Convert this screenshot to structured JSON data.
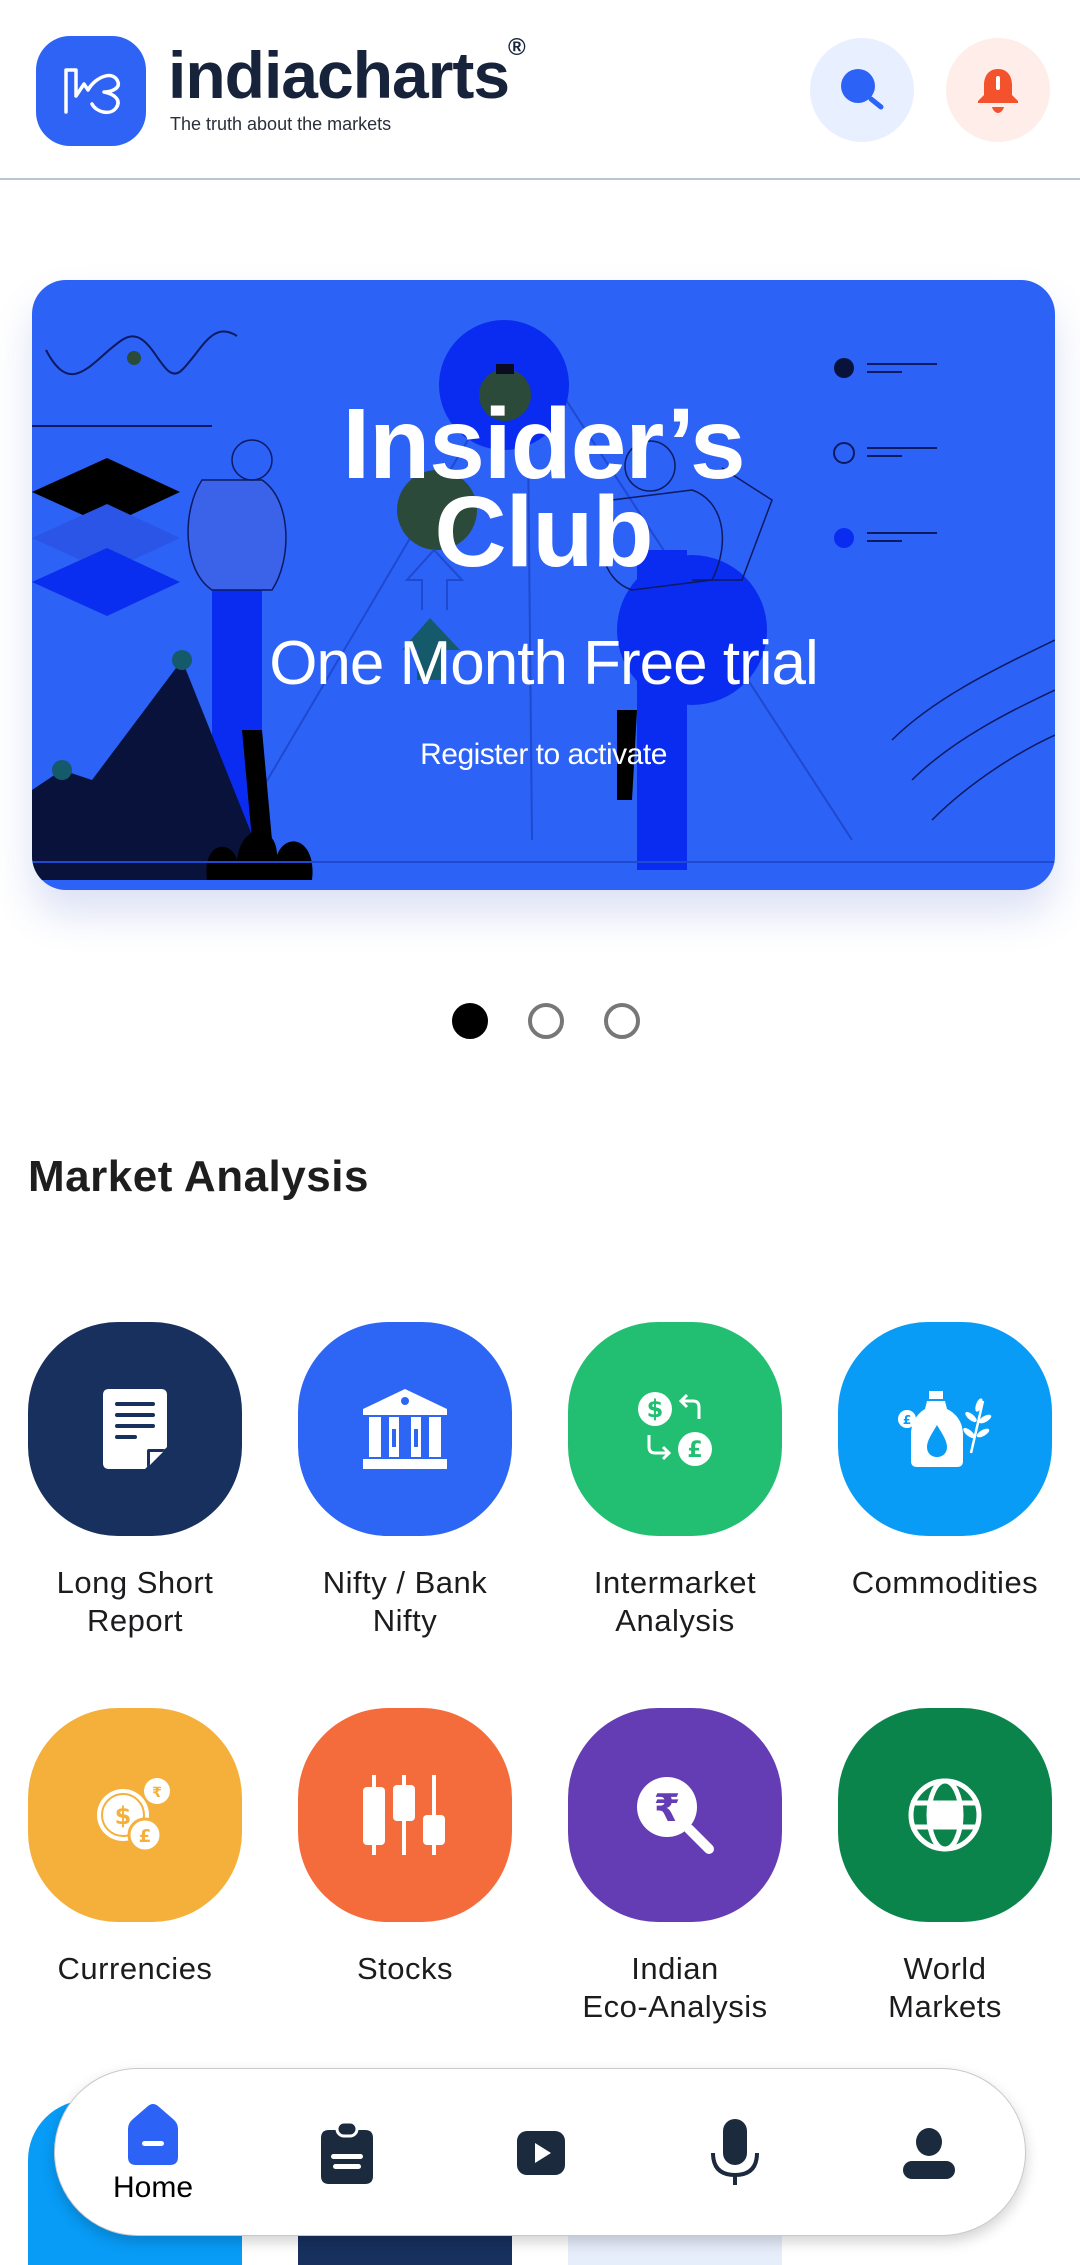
{
  "header": {
    "brand_name": "indiacharts",
    "brand_registered": "®",
    "tagline": "The truth about the markets",
    "search_icon": "search-icon",
    "notification_icon": "bell-icon"
  },
  "banner": {
    "title_line1": "Insider’s",
    "title_line2": "Club",
    "subtitle": "One Month Free trial",
    "cta": "Register to activate",
    "pager": {
      "total": 3,
      "active": 1
    }
  },
  "market_analysis": {
    "title": "Market Analysis",
    "tiles": [
      {
        "label_line1": "Long Short",
        "label_line2": "Report",
        "icon": "document-icon",
        "color": "#17305e"
      },
      {
        "label_line1": "Nifty / Bank",
        "label_line2": "Nifty",
        "icon": "bank-icon",
        "color": "#2d66f5"
      },
      {
        "label_line1": "Intermarket",
        "label_line2": "Analysis",
        "icon": "currency-exchange-icon",
        "color": "#22bf72"
      },
      {
        "label_line1": "Commodities",
        "label_line2": "",
        "icon": "commodity-icon",
        "color": "#089cf7"
      },
      {
        "label_line1": "Currencies",
        "label_line2": "",
        "icon": "coins-icon",
        "color": "#f4b03a"
      },
      {
        "label_line1": "Stocks",
        "label_line2": "",
        "icon": "candlestick-icon",
        "color": "#f46c3c"
      },
      {
        "label_line1": "Indian",
        "label_line2": "Eco-Analysis",
        "icon": "rupee-search-icon",
        "color": "#643db4"
      },
      {
        "label_line1": "World",
        "label_line2": "Markets",
        "icon": "globe-icon",
        "color": "#0b844c"
      }
    ]
  },
  "bottom_nav": {
    "items": [
      {
        "label": "Home",
        "icon": "home-icon",
        "active": true
      },
      {
        "label": "",
        "icon": "clipboard-icon",
        "active": false
      },
      {
        "label": "",
        "icon": "video-icon",
        "active": false
      },
      {
        "label": "",
        "icon": "microphone-icon",
        "active": false
      },
      {
        "label": "",
        "icon": "profile-icon",
        "active": false
      }
    ],
    "active_color": "#2d62f6",
    "inactive_color": "#1b2a3d"
  }
}
